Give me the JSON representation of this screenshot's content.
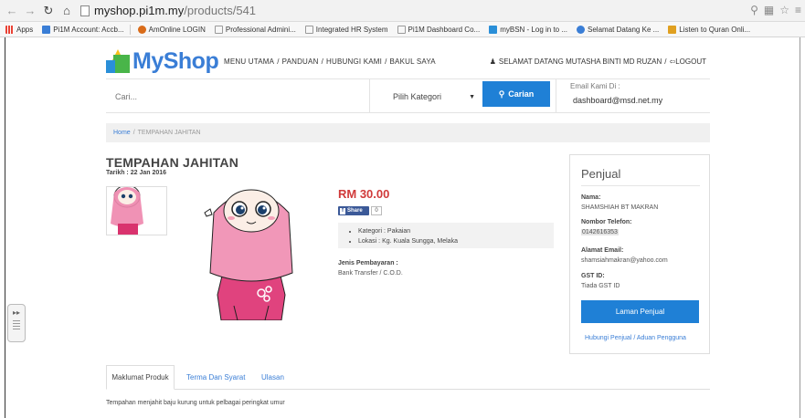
{
  "browser": {
    "url_host": "myshop.pi1m.my",
    "url_path": "/products/541",
    "bookmarks": [
      {
        "label": "Apps",
        "color": "#e94235"
      },
      {
        "label": "Pi1M Account: Accb...",
        "color": "#3a7ed6"
      },
      {
        "label": "AmOnline LOGIN",
        "color": "#d96c1a"
      },
      {
        "label": "Professional Admini...",
        "color": "#bbbbbb"
      },
      {
        "label": "Integrated HR System",
        "color": "#bbbbbb"
      },
      {
        "label": "Pi1M Dashboard Co...",
        "color": "#bbbbbb"
      },
      {
        "label": "myBSN - Log in to ...",
        "color": "#2a8fd8"
      },
      {
        "label": "Selamat Datang Ke ...",
        "color": "#3a7ed6"
      },
      {
        "label": "Listen to Quran Onli...",
        "color": "#e0a020"
      }
    ]
  },
  "site": {
    "logo_text": "MyShop",
    "nav": [
      "MENU UTAMA",
      "/",
      "PANDUAN",
      "/",
      "HUBUNGI KAMI",
      "/",
      "BAKUL SAYA"
    ],
    "greeting": "SELAMAT DATANG MUTASHA BINTI MD RUZAN",
    "greeting_sep": "/",
    "logout": "LOGOUT"
  },
  "search": {
    "placeholder": "Cari...",
    "kategori": "Pilih Kategori",
    "button": "Carian",
    "email_label": "Email Kami Di :",
    "email_value": "dashboard@msd.net.my"
  },
  "breadcrumb": {
    "home": "Home",
    "sep": "/",
    "current": "TEMPAHAN JAHITAN"
  },
  "product": {
    "title": "TEMPAHAN JAHITAN",
    "date": "Tarikh : 22 Jan 2016",
    "price": "RM 30.00",
    "share_label": "Share",
    "share_count": "0",
    "details": [
      "Kategori : Pakaian",
      "Lokasi : Kg. Kuala Sungga, Melaka"
    ],
    "payment_label": "Jenis Pembayaran :",
    "payment_value": "Bank Transfer / C.O.D."
  },
  "seller": {
    "title": "Penjual",
    "name_label": "Nama:",
    "name_value": "SHAMSHIAH BT MAKRAN",
    "phone_label": "Nombor Telefon:",
    "phone_value": "0142616353",
    "email_label": "Alamat Email:",
    "email_value": "shamsiahmakran@yahoo.com",
    "gst_label": "GST ID:",
    "gst_value": "Tiada GST ID",
    "button": "Laman Penjual",
    "link": "Hubungi Penjual / Aduan Pengguna"
  },
  "tabs": [
    "Maklumat Produk",
    "Terma Dan Syarat",
    "Ulasan"
  ],
  "description": "Tempahan menjahit baju kurung untuk pelbagai peringkat umur",
  "colors": {
    "accent": "#1f80d6",
    "price": "#d03a3a",
    "facebook": "#3b5998"
  }
}
